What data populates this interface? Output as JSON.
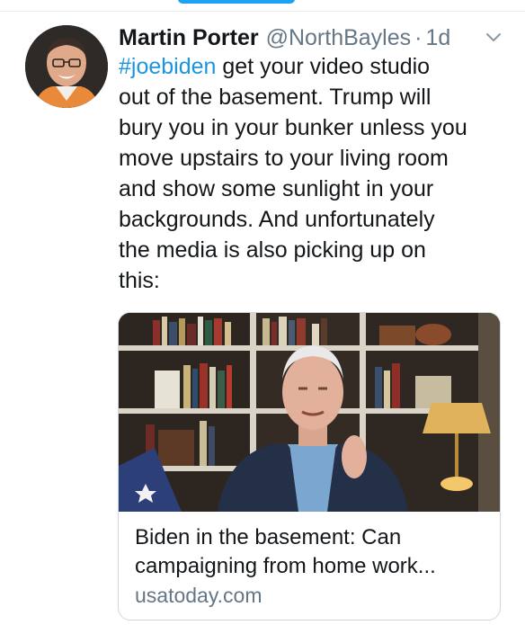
{
  "tweet": {
    "author_name": "Martin Porter",
    "author_handle": "@NorthBayles",
    "separator": "·",
    "timestamp": "1d",
    "text_lines": [
      {
        "hashtag": "#joebiden",
        "rest": " get your video studio"
      },
      "out of the basement.  Trump will",
      "bury you in your bunker unless you",
      "move upstairs to your living room",
      "and show some sunlight in your",
      "backgrounds. And unfortunately",
      "the media is also picking up on",
      "this:"
    ]
  },
  "card": {
    "title_line1": "Biden in the basement: Can",
    "title_line2": "campaigning from home work...",
    "domain": "usatoday.com"
  },
  "icons": {
    "more": "chevron-down-icon"
  },
  "colors": {
    "link": "#1b95e0",
    "secondary_text": "#657786",
    "primary_text": "#14171a",
    "border": "#ccd6dd",
    "accent": "#1da1f2"
  }
}
